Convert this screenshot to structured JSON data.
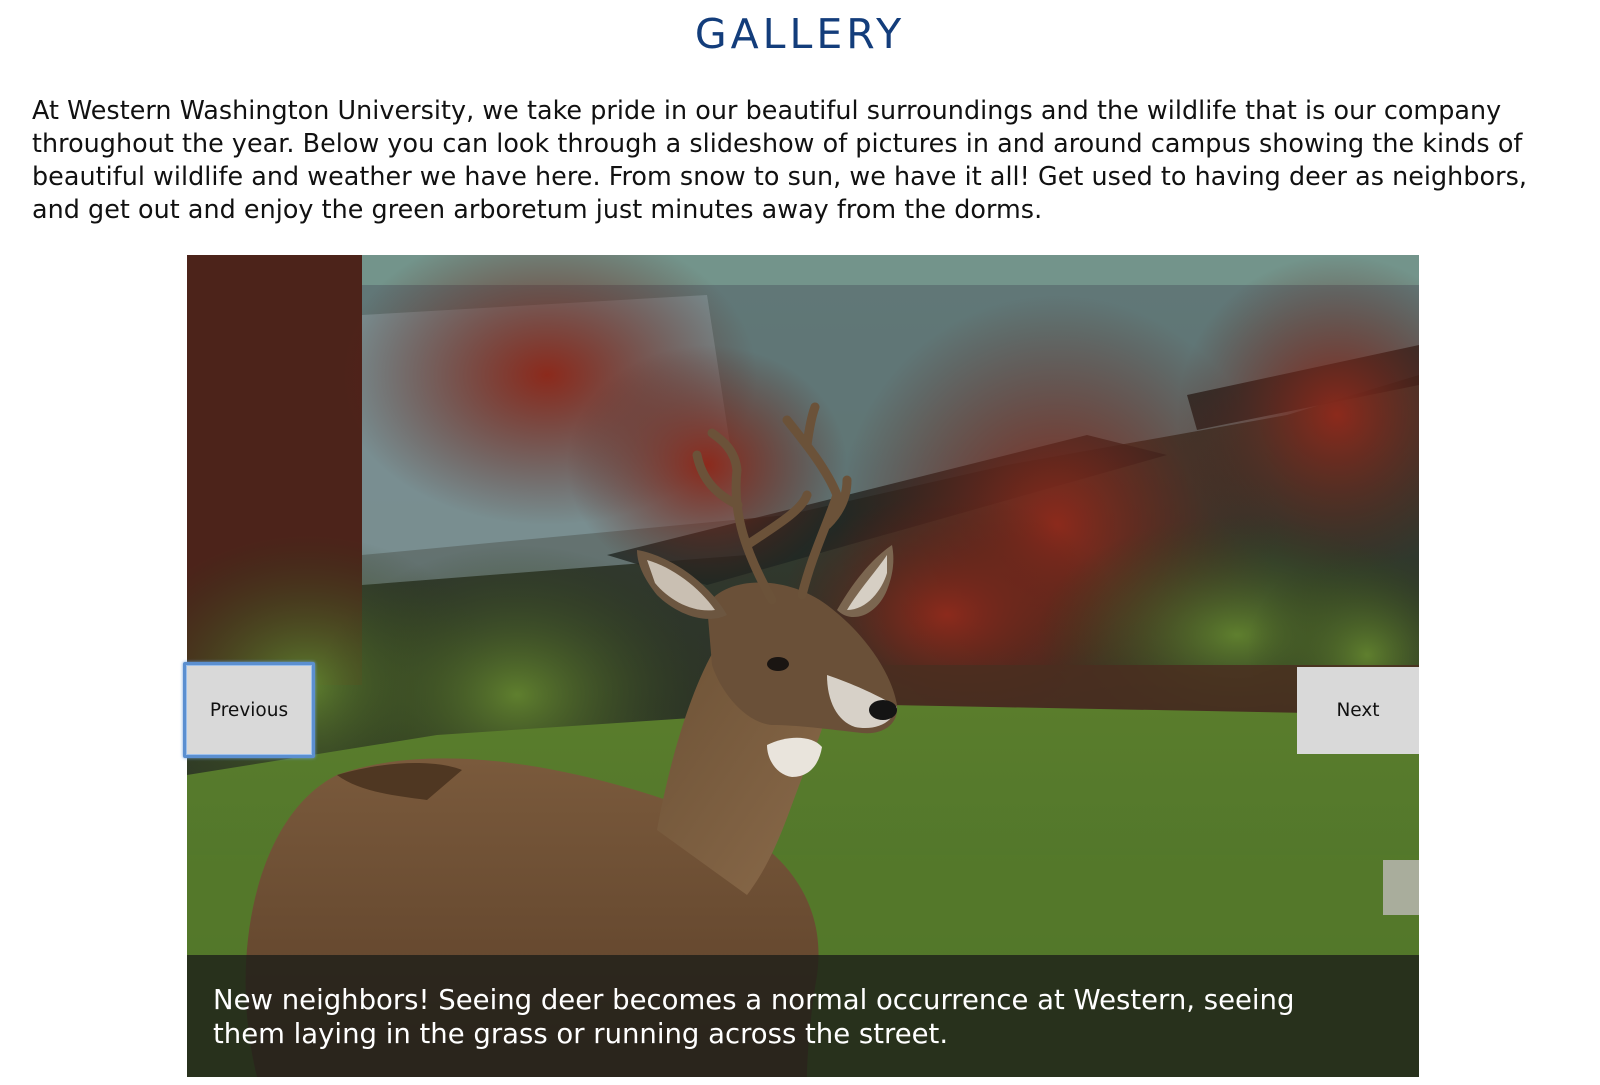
{
  "page": {
    "title": "GALLERY",
    "intro": "At Western Washington University, we take pride in our beautiful surroundings and the wildlife that is our company throughout the year. Below you can look through a slideshow of pictures in and around campus showing the kinds of beautiful wildlife and weather we have here. From snow to sun, we have it all! Get used to having deer as neighbors, and get out and enjoy the green arboretum just minutes away from the dorms."
  },
  "slideshow": {
    "image": "deer lying on grass in front of red and green shrubs",
    "caption": "New neighbors! Seeing deer becomes a normal occurrence at Western, seeing them laying in the grass or running across the street.",
    "prev_label": "Previous",
    "next_label": "Next"
  },
  "colors": {
    "title": "#133d7b",
    "button_bg": "#d9d9d9",
    "focus_ring": "#5b8fd0"
  }
}
